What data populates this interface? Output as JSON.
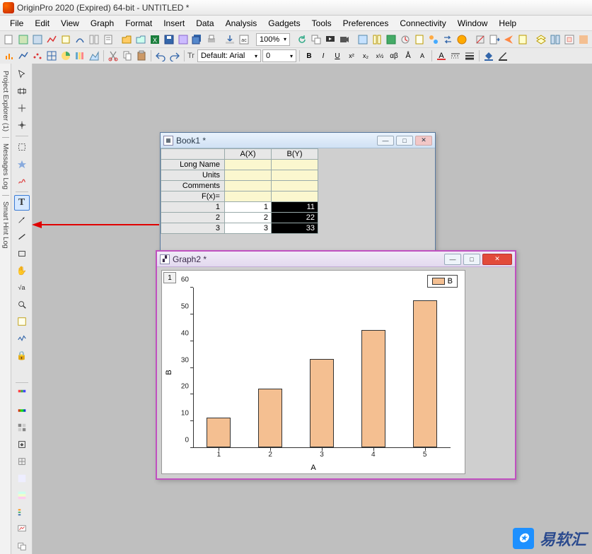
{
  "app": {
    "title": "OriginPro 2020 (Expired) 64-bit - UNTITLED *"
  },
  "menu": {
    "items": [
      "File",
      "Edit",
      "View",
      "Graph",
      "Format",
      "Insert",
      "Data",
      "Analysis",
      "Gadgets",
      "Tools",
      "Preferences",
      "Connectivity",
      "Window",
      "Help"
    ]
  },
  "toolbar": {
    "zoom": "100%",
    "font_label": "Default: Arial",
    "font_prefix": "Tr",
    "font_size": "0",
    "bold": "B",
    "italic": "I",
    "underline": "U"
  },
  "side_tabs": {
    "project_explorer": "Project Explorer (1)",
    "messages_log": "Messages Log",
    "smart_hint_log": "Smart Hint Log"
  },
  "tools": {
    "pointer": "↖",
    "zoom_rect": "⬚",
    "read": "+",
    "region": "⊕",
    "mask": "✦",
    "draw": "✎",
    "text": "T",
    "rect": "▭",
    "line": "—",
    "arrow": "→",
    "pan": "✋",
    "fx": "√a",
    "lock": "🔒"
  },
  "book": {
    "title": "Book1 *",
    "columns": [
      "A(X)",
      "B(Y)"
    ],
    "meta_rows": [
      "Long Name",
      "Units",
      "Comments",
      "F(x)="
    ],
    "data_rows": [
      {
        "n": "1",
        "a": "1",
        "b": "11"
      },
      {
        "n": "2",
        "a": "2",
        "b": "22"
      },
      {
        "n": "3",
        "a": "3",
        "b": "33"
      }
    ]
  },
  "graph": {
    "title": "Graph2 *",
    "layer": "1",
    "legend": "B",
    "xlabel": "A",
    "ylabel": "B",
    "y_ticks": [
      "0",
      "10",
      "20",
      "30",
      "40",
      "50",
      "60"
    ],
    "x_ticks": [
      "1",
      "2",
      "3",
      "4",
      "5"
    ]
  },
  "chart_data": {
    "type": "bar",
    "categories": [
      "1",
      "2",
      "3",
      "4",
      "5"
    ],
    "values": [
      11,
      22,
      33,
      44,
      55
    ],
    "series_name": "B",
    "xlabel": "A",
    "ylabel": "B",
    "ylim": [
      0,
      60
    ]
  },
  "watermark": {
    "text": "易软汇"
  }
}
